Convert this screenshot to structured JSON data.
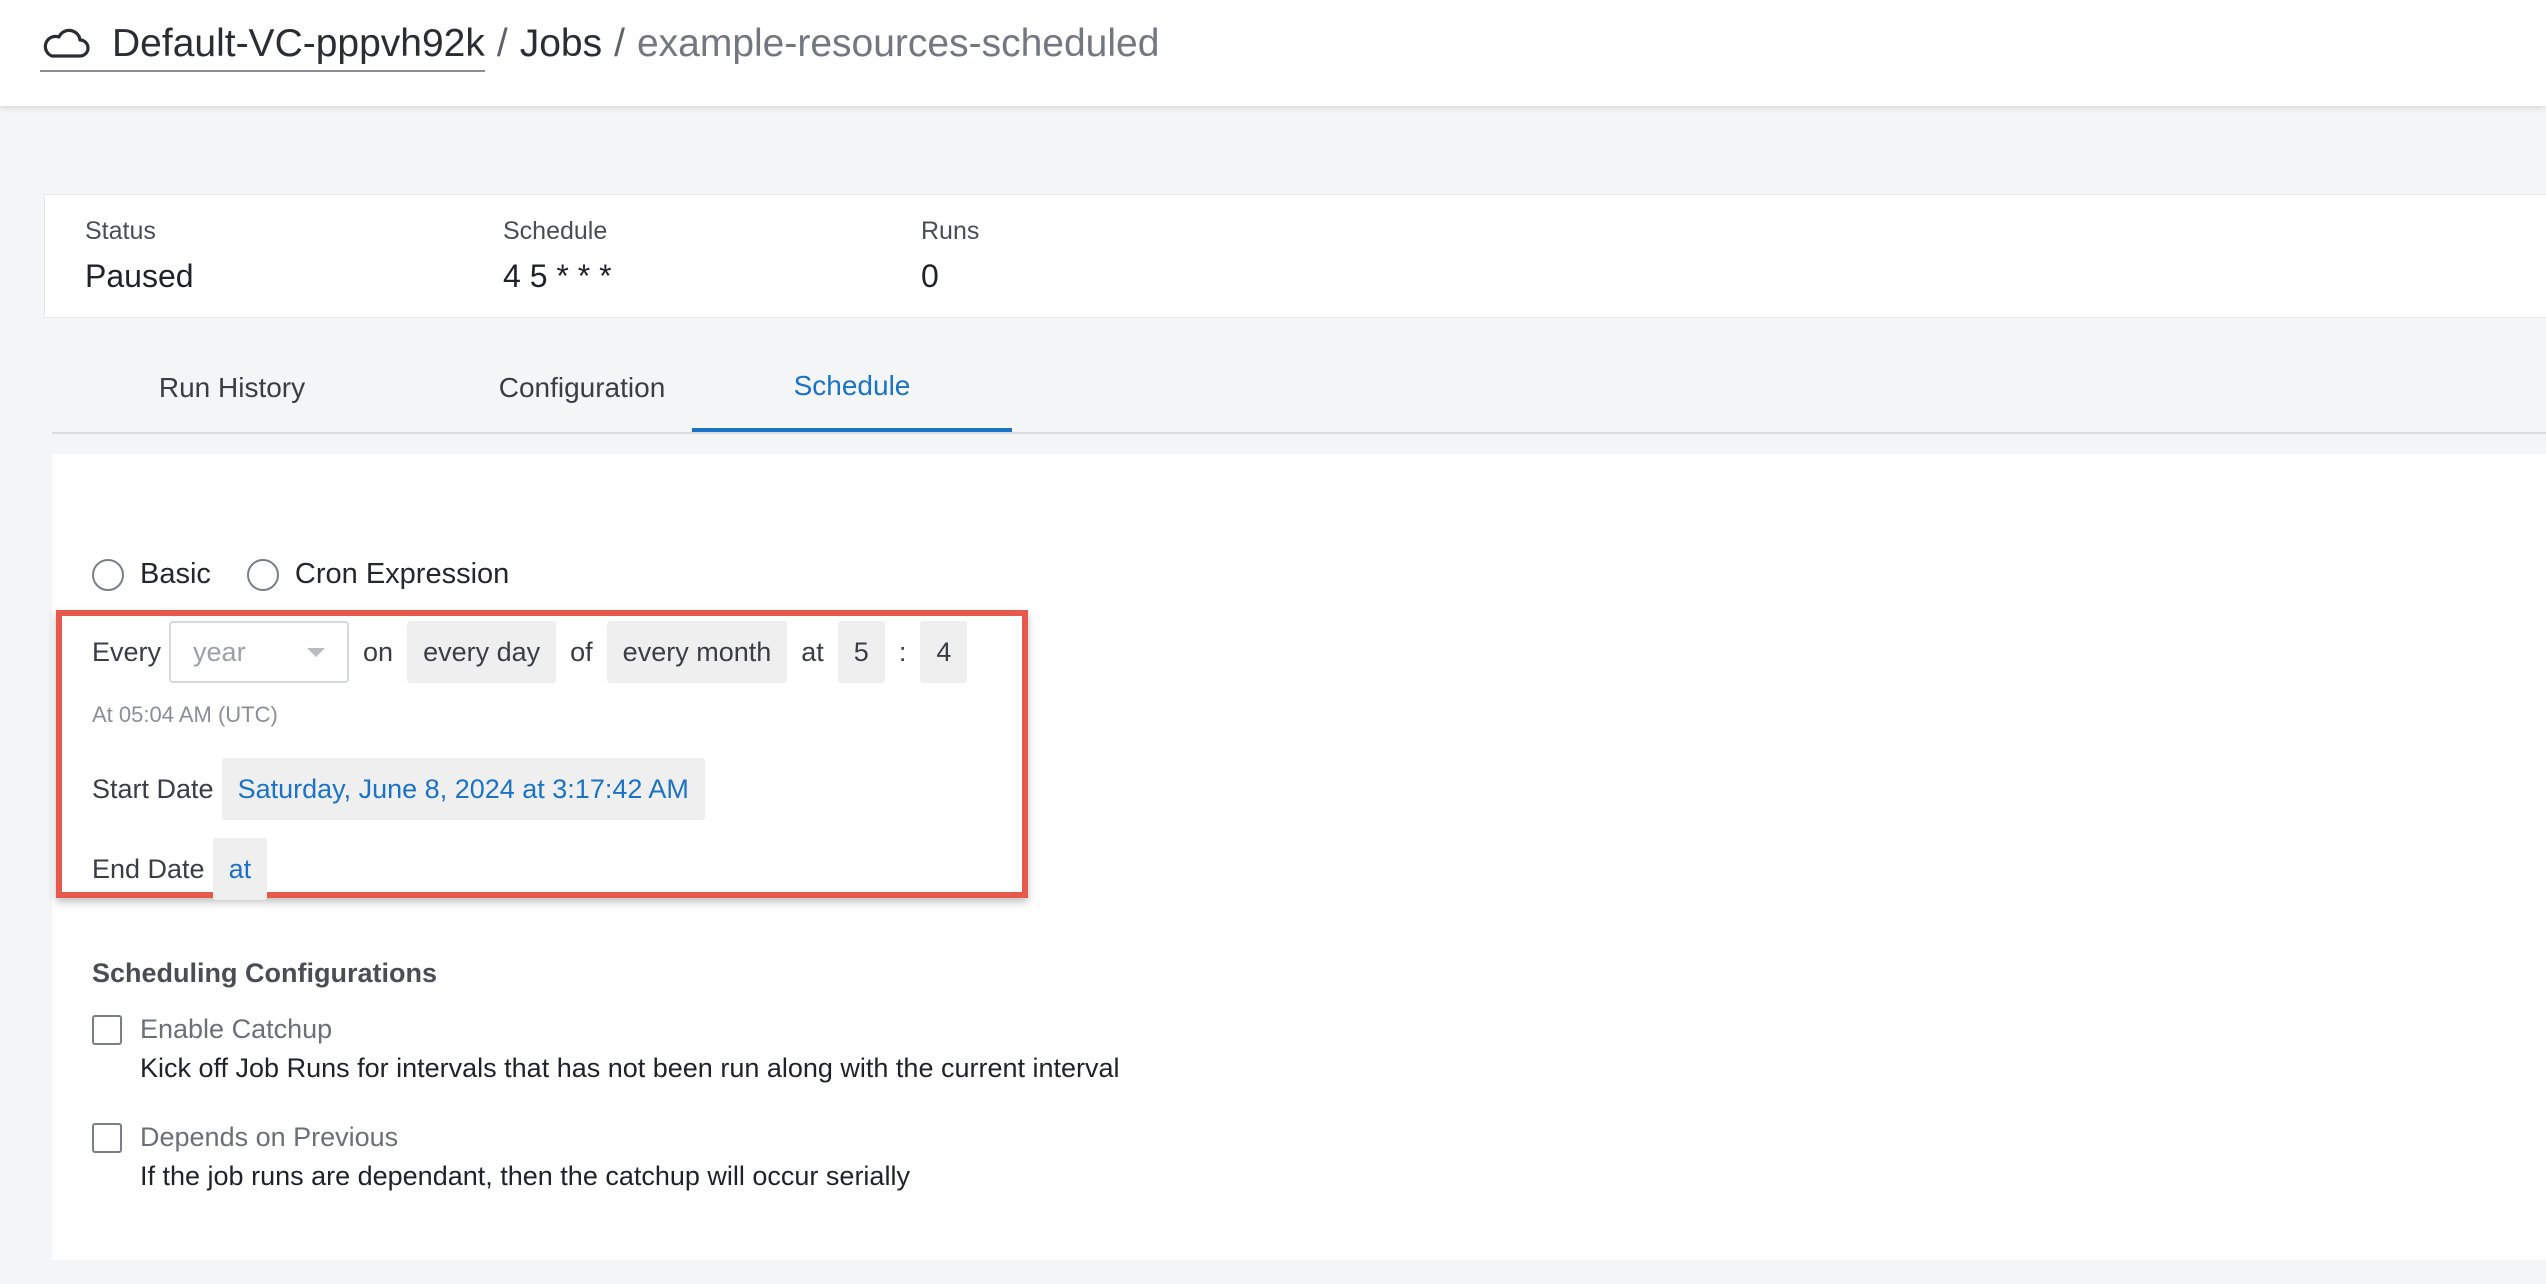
{
  "breadcrumb": {
    "vc": "Default-VC-pppvh92k",
    "separator": "/",
    "jobs": "Jobs",
    "current": "example-resources-scheduled"
  },
  "summary": {
    "status_label": "Status",
    "status_value": "Paused",
    "schedule_label": "Schedule",
    "schedule_value": "4 5 * * *",
    "runs_label": "Runs",
    "runs_value": "0"
  },
  "tabs": [
    {
      "label": "Run History"
    },
    {
      "label": "Configuration"
    },
    {
      "label": "Schedule",
      "active": true
    }
  ],
  "schedule": {
    "mode_options": [
      "Basic",
      "Cron Expression"
    ],
    "every_label": "Every",
    "period_value": "year",
    "on_label": "on",
    "day_value": "every day",
    "of_label": "of",
    "month_value": "every month",
    "at_label": "at",
    "hour_value": "5",
    "colon": ":",
    "minute_value": "4",
    "utc_note": "At 05:04 AM (UTC)",
    "start_label": "Start Date",
    "start_value": "Saturday, June 8, 2024 at 3:17:42 AM",
    "end_label": "End Date",
    "end_value": "at"
  },
  "scheduling_config": {
    "heading": "Scheduling Configurations",
    "catchup_label": "Enable Catchup",
    "catchup_desc": "Kick off Job Runs for intervals that has not been run along with the current interval",
    "depends_label": "Depends on Previous",
    "depends_desc": "If the job runs are dependant, then the catchup will occur serially"
  },
  "colors": {
    "accent": "#1a73c7",
    "highlight": "#e8594d"
  }
}
